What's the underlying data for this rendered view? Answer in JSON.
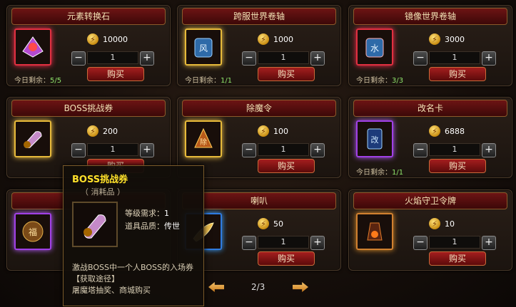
{
  "cards": [
    {
      "title": "元素转换石",
      "price": "10000",
      "qty": "1",
      "buy": "购买",
      "remain_label": "今日剩余：",
      "remain_value": "5/5",
      "icon": "element-stone-icon",
      "frame": "red"
    },
    {
      "title": "跨服世界卷轴",
      "price": "1000",
      "qty": "1",
      "buy": "购买",
      "remain_label": "今日剩余：",
      "remain_value": "1/1",
      "icon": "world-scroll-icon",
      "frame": "gold"
    },
    {
      "title": "镜像世界卷轴",
      "price": "3000",
      "qty": "1",
      "buy": "购买",
      "remain_label": "今日剩余：",
      "remain_value": "3/3",
      "icon": "mirror-scroll-icon",
      "frame": "red"
    },
    {
      "title": "BOSS挑战券",
      "price": "200",
      "qty": "1",
      "buy": "购买",
      "icon": "boss-ticket-icon",
      "frame": "gold"
    },
    {
      "title": "除魔令",
      "price": "100",
      "qty": "1",
      "buy": "购买",
      "icon": "demon-order-icon",
      "frame": "gold"
    },
    {
      "title": "改名卡",
      "price": "6888",
      "qty": "1",
      "buy": "购买",
      "remain_label": "今日剩余：",
      "remain_value": "1/1",
      "icon": "rename-card-icon",
      "frame": "purple"
    },
    {
      "title": "",
      "price": "",
      "qty": "",
      "buy": "",
      "icon": "amulet-icon",
      "frame": "purple"
    },
    {
      "title": "喇叭",
      "price": "50",
      "qty": "1",
      "buy": "购买",
      "icon": "horn-icon",
      "frame": "blue"
    },
    {
      "title": "火焰守卫令牌",
      "price": "10",
      "qty": "1",
      "buy": "购买",
      "icon": "flame-token-icon",
      "frame": "orange"
    }
  ],
  "pager": {
    "text": "2/3"
  },
  "tooltip": {
    "name": "BOSS挑战券",
    "subtitle": "（ 消耗品 ）",
    "level_label": "等级需求：",
    "level_value": "1",
    "quality_label": "道具品质：",
    "quality_value": "传世",
    "desc1": "激战BOSS中一个人BOSS的入场券",
    "desc2": "【获取途径】",
    "desc3": "屠魔塔抽奖、商城购买"
  },
  "colors": {
    "accent": "#6d1414",
    "coin": "#f2c44a",
    "remain": "#8ee36a",
    "tooltip_name": "#ffe12a"
  }
}
